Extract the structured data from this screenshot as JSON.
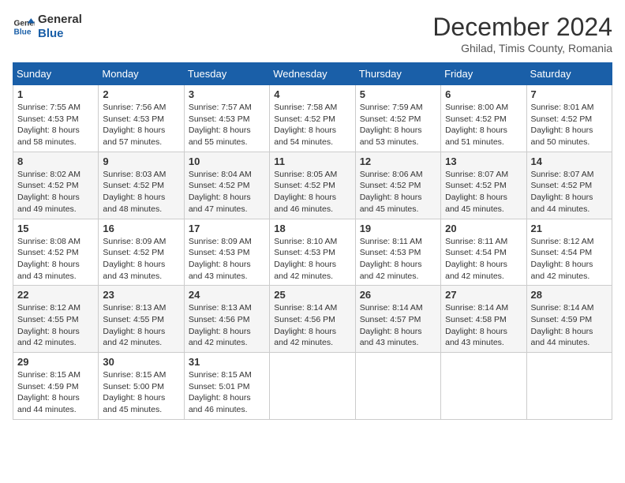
{
  "header": {
    "logo_line1": "General",
    "logo_line2": "Blue",
    "month_title": "December 2024",
    "location": "Ghilad, Timis County, Romania"
  },
  "days_of_week": [
    "Sunday",
    "Monday",
    "Tuesday",
    "Wednesday",
    "Thursday",
    "Friday",
    "Saturday"
  ],
  "weeks": [
    [
      {
        "day": "1",
        "sunrise": "7:55 AM",
        "sunset": "4:53 PM",
        "daylight": "8 hours and 58 minutes."
      },
      {
        "day": "2",
        "sunrise": "7:56 AM",
        "sunset": "4:53 PM",
        "daylight": "8 hours and 57 minutes."
      },
      {
        "day": "3",
        "sunrise": "7:57 AM",
        "sunset": "4:53 PM",
        "daylight": "8 hours and 55 minutes."
      },
      {
        "day": "4",
        "sunrise": "7:58 AM",
        "sunset": "4:52 PM",
        "daylight": "8 hours and 54 minutes."
      },
      {
        "day": "5",
        "sunrise": "7:59 AM",
        "sunset": "4:52 PM",
        "daylight": "8 hours and 53 minutes."
      },
      {
        "day": "6",
        "sunrise": "8:00 AM",
        "sunset": "4:52 PM",
        "daylight": "8 hours and 51 minutes."
      },
      {
        "day": "7",
        "sunrise": "8:01 AM",
        "sunset": "4:52 PM",
        "daylight": "8 hours and 50 minutes."
      }
    ],
    [
      {
        "day": "8",
        "sunrise": "8:02 AM",
        "sunset": "4:52 PM",
        "daylight": "8 hours and 49 minutes."
      },
      {
        "day": "9",
        "sunrise": "8:03 AM",
        "sunset": "4:52 PM",
        "daylight": "8 hours and 48 minutes."
      },
      {
        "day": "10",
        "sunrise": "8:04 AM",
        "sunset": "4:52 PM",
        "daylight": "8 hours and 47 minutes."
      },
      {
        "day": "11",
        "sunrise": "8:05 AM",
        "sunset": "4:52 PM",
        "daylight": "8 hours and 46 minutes."
      },
      {
        "day": "12",
        "sunrise": "8:06 AM",
        "sunset": "4:52 PM",
        "daylight": "8 hours and 45 minutes."
      },
      {
        "day": "13",
        "sunrise": "8:07 AM",
        "sunset": "4:52 PM",
        "daylight": "8 hours and 45 minutes."
      },
      {
        "day": "14",
        "sunrise": "8:07 AM",
        "sunset": "4:52 PM",
        "daylight": "8 hours and 44 minutes."
      }
    ],
    [
      {
        "day": "15",
        "sunrise": "8:08 AM",
        "sunset": "4:52 PM",
        "daylight": "8 hours and 43 minutes."
      },
      {
        "day": "16",
        "sunrise": "8:09 AM",
        "sunset": "4:52 PM",
        "daylight": "8 hours and 43 minutes."
      },
      {
        "day": "17",
        "sunrise": "8:09 AM",
        "sunset": "4:53 PM",
        "daylight": "8 hours and 43 minutes."
      },
      {
        "day": "18",
        "sunrise": "8:10 AM",
        "sunset": "4:53 PM",
        "daylight": "8 hours and 42 minutes."
      },
      {
        "day": "19",
        "sunrise": "8:11 AM",
        "sunset": "4:53 PM",
        "daylight": "8 hours and 42 minutes."
      },
      {
        "day": "20",
        "sunrise": "8:11 AM",
        "sunset": "4:54 PM",
        "daylight": "8 hours and 42 minutes."
      },
      {
        "day": "21",
        "sunrise": "8:12 AM",
        "sunset": "4:54 PM",
        "daylight": "8 hours and 42 minutes."
      }
    ],
    [
      {
        "day": "22",
        "sunrise": "8:12 AM",
        "sunset": "4:55 PM",
        "daylight": "8 hours and 42 minutes."
      },
      {
        "day": "23",
        "sunrise": "8:13 AM",
        "sunset": "4:55 PM",
        "daylight": "8 hours and 42 minutes."
      },
      {
        "day": "24",
        "sunrise": "8:13 AM",
        "sunset": "4:56 PM",
        "daylight": "8 hours and 42 minutes."
      },
      {
        "day": "25",
        "sunrise": "8:14 AM",
        "sunset": "4:56 PM",
        "daylight": "8 hours and 42 minutes."
      },
      {
        "day": "26",
        "sunrise": "8:14 AM",
        "sunset": "4:57 PM",
        "daylight": "8 hours and 43 minutes."
      },
      {
        "day": "27",
        "sunrise": "8:14 AM",
        "sunset": "4:58 PM",
        "daylight": "8 hours and 43 minutes."
      },
      {
        "day": "28",
        "sunrise": "8:14 AM",
        "sunset": "4:59 PM",
        "daylight": "8 hours and 44 minutes."
      }
    ],
    [
      {
        "day": "29",
        "sunrise": "8:15 AM",
        "sunset": "4:59 PM",
        "daylight": "8 hours and 44 minutes."
      },
      {
        "day": "30",
        "sunrise": "8:15 AM",
        "sunset": "5:00 PM",
        "daylight": "8 hours and 45 minutes."
      },
      {
        "day": "31",
        "sunrise": "8:15 AM",
        "sunset": "5:01 PM",
        "daylight": "8 hours and 46 minutes."
      },
      null,
      null,
      null,
      null
    ]
  ],
  "labels": {
    "sunrise": "Sunrise:",
    "sunset": "Sunset:",
    "daylight": "Daylight:"
  }
}
